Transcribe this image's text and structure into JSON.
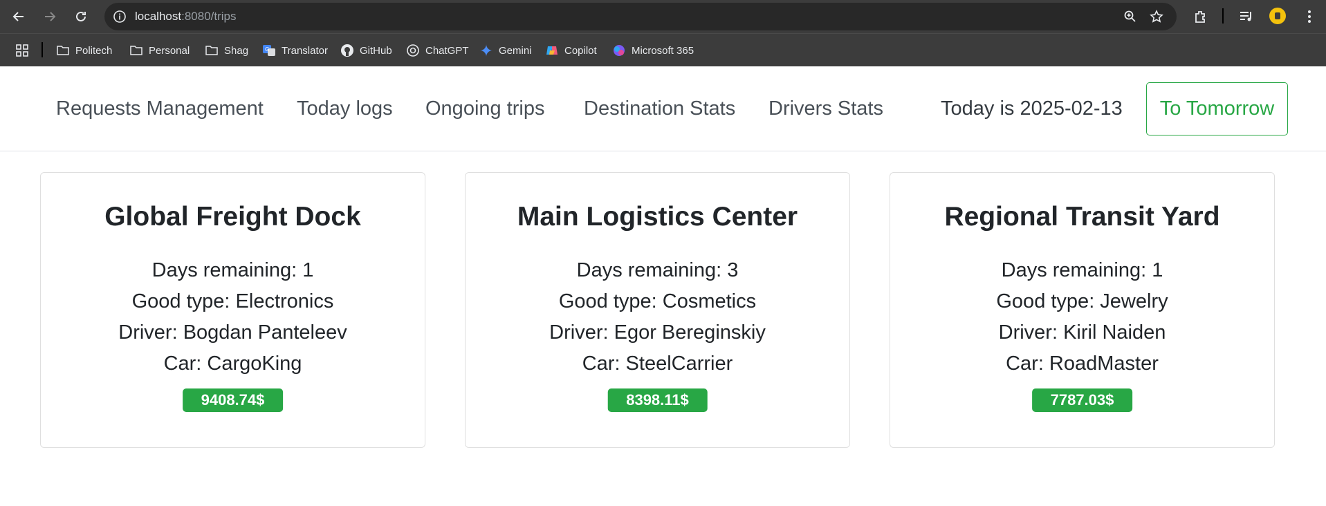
{
  "browser": {
    "url_host": "localhost",
    "url_path": ":8080/trips",
    "bookmarks": [
      {
        "label": "Politech",
        "icon": "folder-icon"
      },
      {
        "label": "Personal",
        "icon": "folder-icon"
      },
      {
        "label": "Shag",
        "icon": "folder-icon"
      },
      {
        "label": "Translator",
        "icon": "translator-icon"
      },
      {
        "label": "GitHub",
        "icon": "github-icon"
      },
      {
        "label": "ChatGPT",
        "icon": "chatgpt-icon"
      },
      {
        "label": "Gemini",
        "icon": "gemini-icon"
      },
      {
        "label": "Copilot",
        "icon": "copilot-icon"
      },
      {
        "label": "Microsoft 365",
        "icon": "microsoft365-icon"
      }
    ]
  },
  "nav": {
    "links": [
      "Requests Management",
      "Today logs",
      "Ongoing trips",
      "Destination Stats",
      "Drivers Stats"
    ],
    "today": "Today is 2025-02-13",
    "tomorrow_button": "To Tomorrow"
  },
  "trips": [
    {
      "destination": "Global Freight Dock",
      "days": "Days remaining: 1",
      "good": "Good type: Electronics",
      "driver": "Driver: Bogdan Panteleev",
      "car": "Car: CargoKing",
      "price": "9408.74$"
    },
    {
      "destination": "Main Logistics Center",
      "days": "Days remaining: 3",
      "good": "Good type: Cosmetics",
      "driver": "Driver: Egor Bereginskiy",
      "car": "Car: SteelCarrier",
      "price": "8398.11$"
    },
    {
      "destination": "Regional Transit Yard",
      "days": "Days remaining: 1",
      "good": "Good type: Jewelry",
      "driver": "Driver: Kiril Naiden",
      "car": "Car: RoadMaster",
      "price": "7787.03$"
    }
  ],
  "colors": {
    "accent_green": "#28a745",
    "chrome_dark": "#3c3c3c"
  }
}
